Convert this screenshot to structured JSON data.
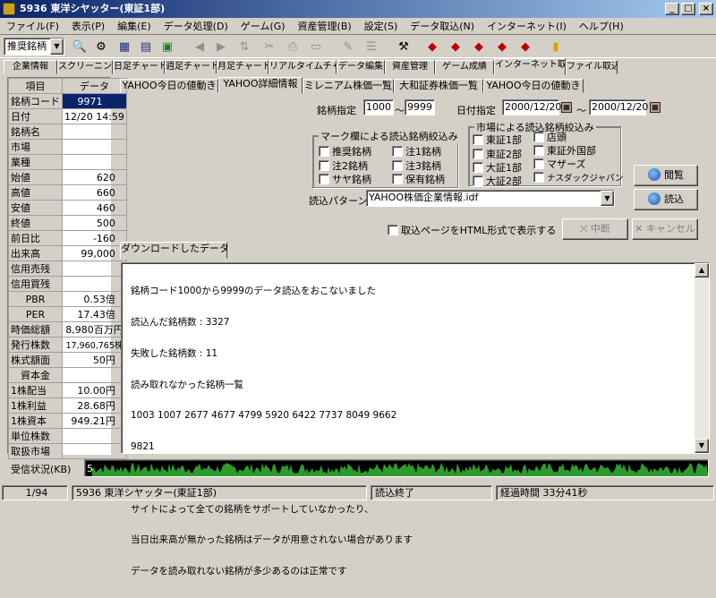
{
  "window": {
    "title": "5936 東洋シヤッター(東証1部)",
    "min": "_",
    "max": "□",
    "close": "×"
  },
  "menu": [
    "ファイル(F)",
    "表示(P)",
    "編集(E)",
    "データ処理(D)",
    "ゲーム(G)",
    "資産管理(B)",
    "設定(S)",
    "データ取込(N)",
    "インターネット(I)",
    "ヘルプ(H)"
  ],
  "toolbar": {
    "combo": "推奨銘柄"
  },
  "main_tabs": [
    "企業情報",
    "スクリーニング",
    "日足チャート",
    "週足チャート",
    "月足チャート",
    "リアルタイムチャート",
    "データ編集",
    "資産管理",
    "ゲーム成績",
    "インターネット取込",
    "ファイル取込"
  ],
  "left": {
    "headers": [
      "項目",
      "データ"
    ],
    "rows": [
      {
        "k": "銘柄コード",
        "v": "9971"
      },
      {
        "k": "日付",
        "v": "12/20 14:59"
      },
      {
        "k": "銘柄名",
        "v": ""
      },
      {
        "k": "市場",
        "v": ""
      },
      {
        "k": "業種",
        "v": ""
      },
      {
        "k": "始値",
        "v": "620"
      },
      {
        "k": "高値",
        "v": "660"
      },
      {
        "k": "安値",
        "v": "460"
      },
      {
        "k": "終値",
        "v": "500"
      },
      {
        "k": "前日比",
        "v": "-160"
      },
      {
        "k": "出来高",
        "v": "99,000"
      },
      {
        "k": "信用売残",
        "v": ""
      },
      {
        "k": "信用買残",
        "v": ""
      },
      {
        "k": "PBR",
        "v": "0.53倍"
      },
      {
        "k": "PER",
        "v": "17.43倍"
      },
      {
        "k": "時価総額",
        "v": "8,980百万円"
      },
      {
        "k": "発行株数",
        "v": "17,960,765株"
      },
      {
        "k": "株式額面",
        "v": "50円"
      },
      {
        "k": "資本金",
        "v": ""
      },
      {
        "k": "1株配当",
        "v": "10.00円"
      },
      {
        "k": "1株利益",
        "v": "28.68円"
      },
      {
        "k": "1株資本",
        "v": "949.21円"
      },
      {
        "k": "単位株数",
        "v": ""
      },
      {
        "k": "取扱市場",
        "v": ""
      }
    ]
  },
  "sub_tabs": [
    "YAHOO今日の値動き",
    "YAHOO詳細情報",
    "ミレニアム株価一覧",
    "大和証券株価一覧",
    "YAHOO今日の値動き"
  ],
  "form": {
    "code_label": "銘柄指定",
    "code_from": "1000",
    "tilde": "〜",
    "code_to": "9999",
    "date_label": "日付指定",
    "date_from": "2000/12/20",
    "date_to": "2000/12/20",
    "mark_group": "マーク欄による読込銘柄絞込み",
    "mark_items": [
      "推奨銘柄",
      "注1銘柄",
      "注2銘柄",
      "注3銘柄",
      "サヤ銘柄",
      "保有銘柄"
    ],
    "market_group": "市場による読込銘柄絞込み",
    "market_items": [
      "東証1部",
      "店頭",
      "東証2部",
      "東証外国部",
      "大証1部",
      "マザーズ",
      "大証2部",
      "ナスダックジャパン"
    ],
    "pattern_label": "読込パターン",
    "pattern_value": "YAHOO株価企業情報.idf",
    "browse": "閲覧",
    "read": "読込",
    "html_check": "取込ページをHTML形式で表示する",
    "stop": "中断",
    "cancel": "キャンセル"
  },
  "download": {
    "tab": "ダウンロードしたデータ",
    "lines": [
      "銘柄コード1000から9999のデータ読込をおこないました",
      "読込んだ銘柄数 : 3327",
      "失敗した銘柄数 : 11",
      "読み取れなかった銘柄一覧",
      "1003 1007 2677 4677 4799 5920 6422 7737 8049 9662",
      "9821",
      "",
      "サイトによって全ての銘柄をサポートしていなかったり、",
      "当日出来高が無かった銘柄はデータが用意されない場合があります",
      "データを読み取れない銘柄が多少あるのは正常です"
    ]
  },
  "rx": {
    "label": "受信状況(KB)",
    "value": "5"
  },
  "status": {
    "page": "1/94",
    "stock": "5936 東洋シヤッター(東証1部)",
    "state": "読込終了",
    "elapsed": "経過時間 33分41秒"
  }
}
